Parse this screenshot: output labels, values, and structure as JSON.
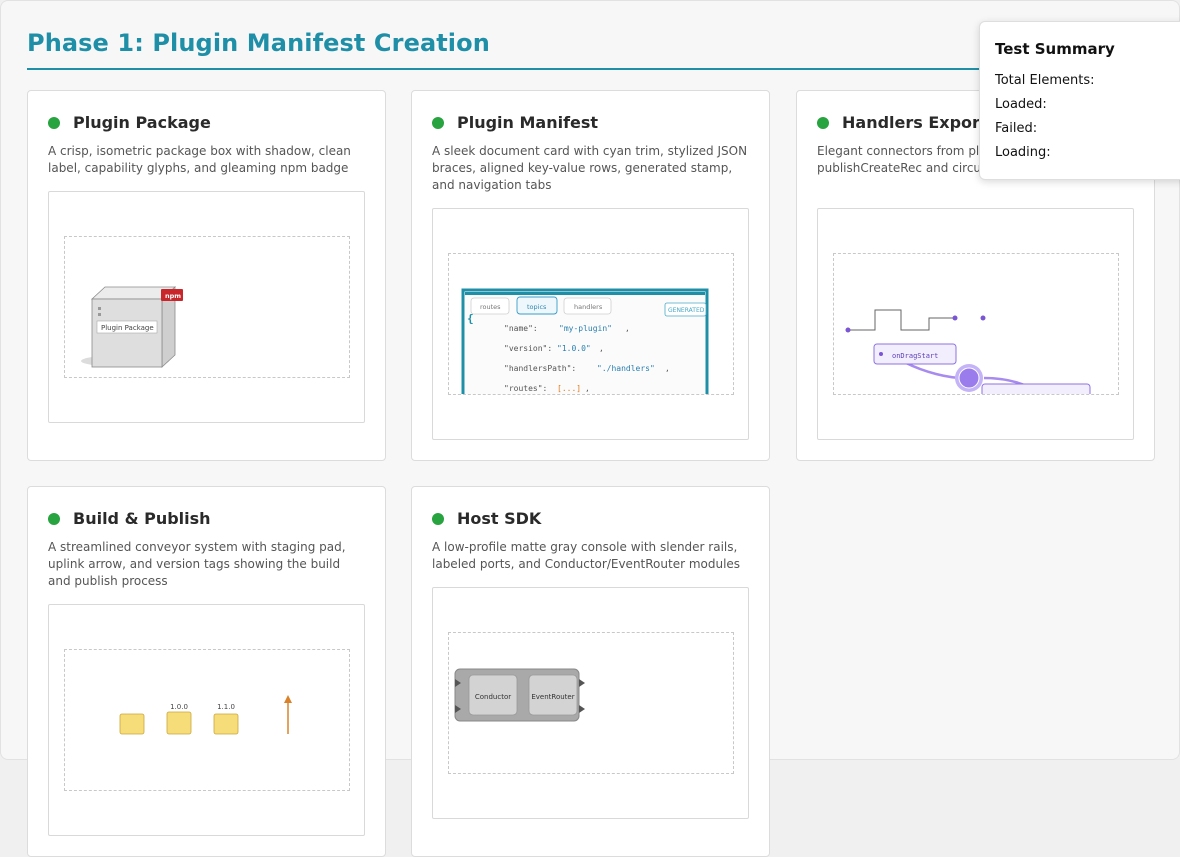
{
  "phase_title": "Phase 1: Plugin Manifest Creation",
  "cards": [
    {
      "title": "Plugin Package",
      "desc": "A crisp, isometric package box with shadow, clean label, capability glyphs, and gleaming npm badge",
      "status_color": "#27a33f"
    },
    {
      "title": "Plugin Manifest",
      "desc": "A sleek document card with cyan trim, stylized JSON braces, aligned key-value rows, generated stamp, and navigation tabs",
      "status_color": "#27a33f"
    },
    {
      "title": "Handlers Export",
      "desc": "Elegant connectors from plugin (onDragStart, publishCreateRec and circuit traces",
      "status_color": "#27a33f"
    },
    {
      "title": "Build & Publish",
      "desc": "A streamlined conveyor system with staging pad, uplink arrow, and version tags showing the build and publish process",
      "status_color": "#27a33f"
    },
    {
      "title": "Host SDK",
      "desc": "A low-profile matte gray console with slender rails, labeled ports, and Conductor/EventRouter modules",
      "status_color": "#27a33f"
    }
  ],
  "package_art": {
    "label": "Plugin Package",
    "badge": "npm"
  },
  "manifest_art": {
    "tabs": [
      "routes",
      "topics",
      "handlers"
    ],
    "stamp": "GENERATED",
    "brace": "{",
    "rows": [
      {
        "key": "\"name\":",
        "value": "\"my-plugin\"",
        "tail": ","
      },
      {
        "key": "\"version\":",
        "value": "\"1.0.0\"",
        "tail": ","
      },
      {
        "key": "\"handlersPath\":",
        "value": "\"./handlers\"",
        "tail": ","
      },
      {
        "key": "\"routes\":",
        "value": "[...]",
        "tail": ","
      }
    ]
  },
  "handlers_art": {
    "handler_label": "onDragStart"
  },
  "build_art": {
    "tags": [
      "1.0.0",
      "1.1.0"
    ]
  },
  "sdk_art": {
    "modules": [
      "Conductor",
      "EventRouter"
    ]
  },
  "summary": {
    "title": "Test Summary",
    "rows": [
      "Total Elements:",
      "Loaded:",
      "Failed:",
      "Loading:"
    ]
  }
}
